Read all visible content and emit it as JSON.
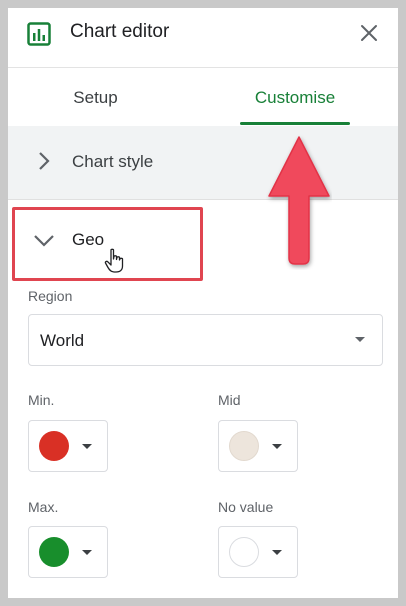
{
  "header": {
    "title": "Chart editor",
    "icon": "bar-chart-icon",
    "close_icon": "close-icon",
    "accent": "#188038"
  },
  "tabs": [
    {
      "label": "Setup",
      "active": false
    },
    {
      "label": "Customise",
      "active": true
    }
  ],
  "sections": {
    "chart_style": {
      "label": "Chart style",
      "expanded": false
    },
    "geo": {
      "label": "Geo",
      "expanded": true
    }
  },
  "geo": {
    "region": {
      "label": "Region",
      "value": "World"
    },
    "min": {
      "label": "Min.",
      "color": "#d93025"
    },
    "mid": {
      "label": "Mid",
      "color": "#ede5dc"
    },
    "max": {
      "label": "Max.",
      "color": "#188e2c"
    },
    "no_value": {
      "label": "No value",
      "color": "#ffffff"
    }
  },
  "annotation": {
    "highlight_color": "#e04550",
    "arrow_color": "#f0495b"
  }
}
